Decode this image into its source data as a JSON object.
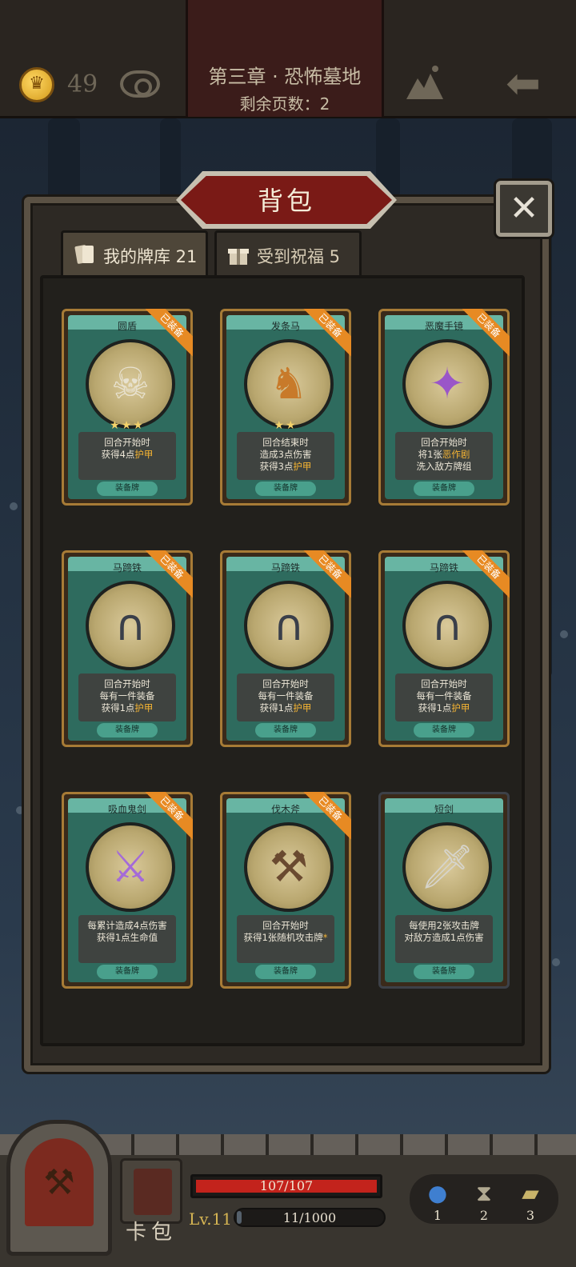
{
  "topbar": {
    "coins": "49",
    "chapter_title": "第三章 · 恐怖墓地",
    "pages_left": "剩余页数：2"
  },
  "panel": {
    "title": "背包",
    "close_label": "✕",
    "tabs": [
      {
        "label": "我的牌库 21",
        "active": true
      },
      {
        "label": "受到祝福 5",
        "active": false
      }
    ]
  },
  "cards": [
    {
      "name": "圆盾",
      "equipped_badge": "已装备",
      "stars": "★★★",
      "desc_lines": [
        "回合开始时",
        "获得4点"
      ],
      "desc_hl": "护甲",
      "type": "装备牌",
      "icon": "skull-shield-icon"
    },
    {
      "name": "发条马",
      "equipped_badge": "已装备",
      "stars": "★★",
      "desc_lines": [
        "回合结束时",
        "造成3点伤害",
        "获得3点"
      ],
      "desc_hl": "护甲",
      "type": "装备牌",
      "icon": "clockwork-horse-icon"
    },
    {
      "name": "恶魔手镜",
      "equipped_badge": "已装备",
      "stars": "",
      "desc_lines": [
        "回合开始时",
        "将1张"
      ],
      "desc_hl": "恶作剧",
      "desc_tail": "洗入敌方牌组",
      "type": "装备牌",
      "icon": "demon-mirror-icon"
    },
    {
      "name": "马蹄铁",
      "equipped_badge": "已装备",
      "stars": "",
      "desc_lines": [
        "回合开始时",
        "每有一件装备",
        "获得1点"
      ],
      "desc_hl": "护甲",
      "type": "装备牌",
      "icon": "horseshoe-icon"
    },
    {
      "name": "马蹄铁",
      "equipped_badge": "已装备",
      "stars": "",
      "desc_lines": [
        "回合开始时",
        "每有一件装备",
        "获得1点"
      ],
      "desc_hl": "护甲",
      "type": "装备牌",
      "icon": "horseshoe-icon"
    },
    {
      "name": "马蹄铁",
      "equipped_badge": "已装备",
      "stars": "",
      "desc_lines": [
        "回合开始时",
        "每有一件装备",
        "获得1点"
      ],
      "desc_hl": "护甲",
      "type": "装备牌",
      "icon": "horseshoe-icon"
    },
    {
      "name": "吸血鬼剑",
      "equipped_badge": "已装备",
      "stars": "",
      "desc_lines": [
        "每累计造成4点伤害",
        "获得1点生命值"
      ],
      "desc_hl": "",
      "type": "装备牌",
      "icon": "vampire-sword-icon"
    },
    {
      "name": "伐木斧",
      "equipped_badge": "已装备",
      "stars": "",
      "desc_lines": [
        "回合开始时",
        "获得1张随机攻击牌"
      ],
      "desc_hl": "*",
      "type": "装备牌",
      "icon": "axe-icon"
    },
    {
      "name": "短剑",
      "equipped_badge": "",
      "stars": "",
      "desc_lines": [
        "每使用2张攻击牌",
        "对敌方造成1点伤害"
      ],
      "desc_hl": "",
      "type": "装备牌",
      "icon": "short-sword-icon"
    }
  ],
  "hud": {
    "deck_label": "卡包",
    "hp_text": "107/107",
    "hp_fraction": 1.0,
    "level": "Lv.11",
    "xp_text": "11/1000",
    "xp_fraction": 0.011,
    "slots": [
      {
        "num": "1",
        "icon": "potion-icon"
      },
      {
        "num": "2",
        "icon": "hourglass-icon"
      },
      {
        "num": "3",
        "icon": "cards-icon"
      }
    ]
  },
  "colors": {
    "accent_orange": "#e78a23",
    "highlight_gold": "#f2b233",
    "card_teal": "#2e6b5e",
    "banner_red": "#7a1a16",
    "hp_red": "#c3231c"
  }
}
